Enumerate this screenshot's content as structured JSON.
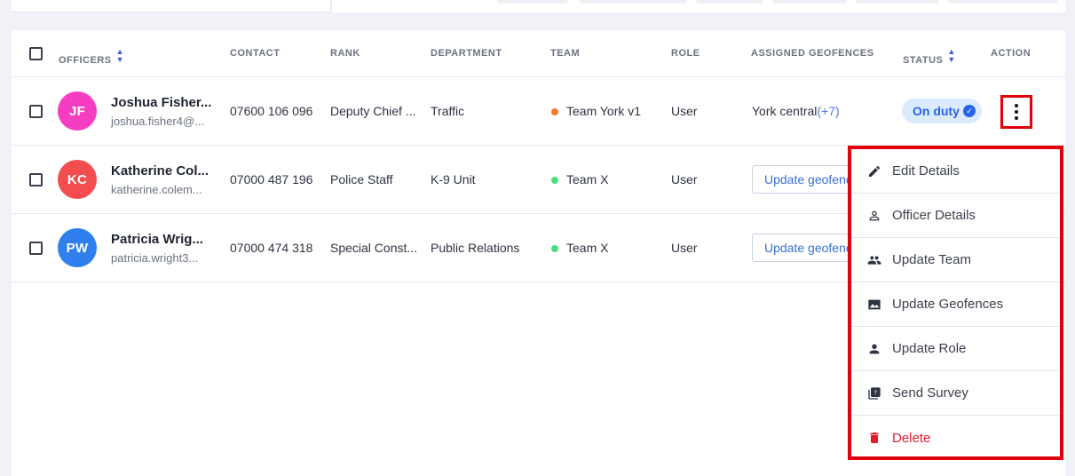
{
  "header": {
    "officers": "OFFICERS",
    "contact": "CONTACT",
    "rank": "RANK",
    "department": "DEPARTMENT",
    "team": "TEAM",
    "role": "ROLE",
    "geofences": "ASSIGNED GEOFENCES",
    "status": "STATUS",
    "action": "ACTION"
  },
  "rows": [
    {
      "initials": "JF",
      "avatar_color": "#f53dc2",
      "name": "Joshua Fisher...",
      "email": "joshua.fisher4@...",
      "contact": "07600 106 096",
      "rank": "Deputy Chief ...",
      "department": "Traffic",
      "team": "Team York v1",
      "team_dot_color": "#f07b2a",
      "role": "User",
      "geofence": "York central",
      "geofence_more": "(+7)",
      "status": "On duty"
    },
    {
      "initials": "KC",
      "avatar_color": "#f44d50",
      "name": "Katherine Col...",
      "email": "katherine.colem...",
      "contact": "07000 487 196",
      "rank": "Police Staff",
      "department": "K-9 Unit",
      "team": "Team X",
      "team_dot_color": "#4ade80",
      "role": "User",
      "geofence_button": "Update geofences"
    },
    {
      "initials": "PW",
      "avatar_color": "#2f80ed",
      "name": "Patricia Wrig...",
      "email": "patricia.wright3...",
      "contact": "07000 474 318",
      "rank": "Special Const...",
      "department": "Public Relations",
      "team": "Team X",
      "team_dot_color": "#4ade80",
      "role": "User",
      "geofence_button": "Update geofences"
    }
  ],
  "menu": {
    "items": [
      {
        "label": "Edit Details",
        "icon": "pencil-icon"
      },
      {
        "label": "Officer Details",
        "icon": "person-outline-icon"
      },
      {
        "label": "Update Team",
        "icon": "people-icon"
      },
      {
        "label": "Update Geofences",
        "icon": "map-icon"
      },
      {
        "label": "Update Role",
        "icon": "person-icon"
      },
      {
        "label": "Send Survey",
        "icon": "survey-icon"
      },
      {
        "label": "Delete",
        "icon": "trash-icon",
        "color": "#e11d2a"
      }
    ]
  },
  "colors": {
    "highlight": "#e0000b",
    "accent": "#2563eb",
    "status_bg": "#dbeafe"
  }
}
